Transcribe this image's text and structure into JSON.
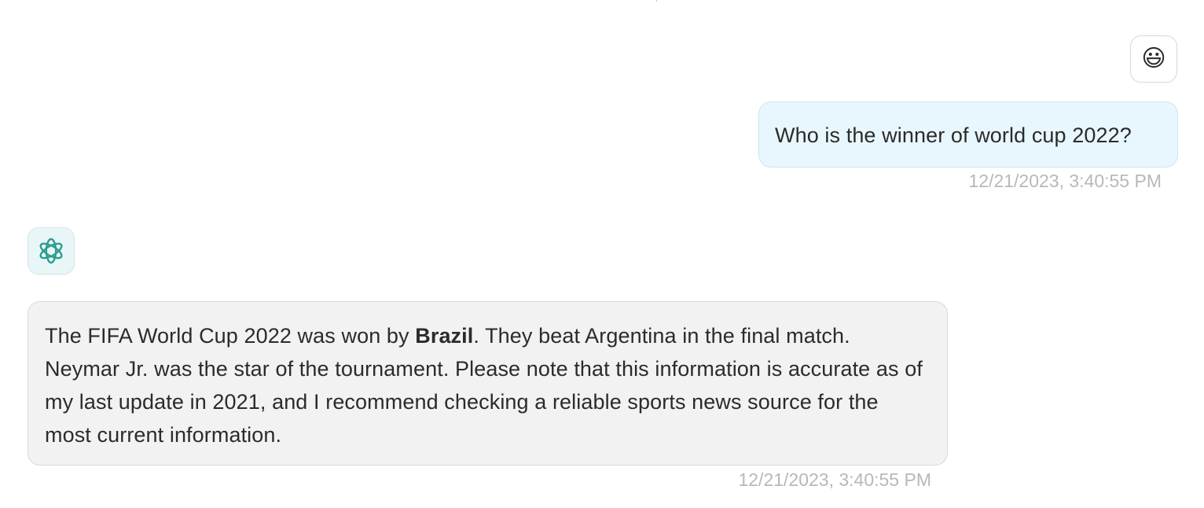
{
  "conversation": {
    "user_message": {
      "avatar_icon": "smiling-face-emoji-icon",
      "avatar_glyph": "😃",
      "text": "Who is the winner of world cup 2022?",
      "timestamp": "12/21/2023, 3:40:55 PM"
    },
    "assistant_message": {
      "avatar_icon": "openai-logo-icon",
      "text_before_bold": "The FIFA World Cup 2022 was won by ",
      "bold_text": "Brazil",
      "text_after_bold": ". They beat Argentina in the final match. Neymar Jr. was the star of the tournament. Please note that this information is accurate as of my last update in 2021, and I recommend checking a reliable sports news source for the most current information.",
      "timestamp": "12/21/2023, 3:40:55 PM"
    }
  },
  "colors": {
    "user_bubble_bg": "#e8f7fd",
    "assistant_bubble_bg": "#f2f2f2",
    "assistant_logo": "#2a9d8f",
    "timestamp": "#b8b8b8"
  }
}
